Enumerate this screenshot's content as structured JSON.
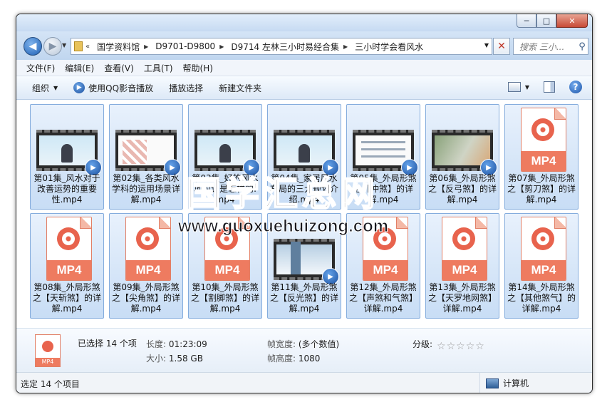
{
  "window": {
    "minimize": "─",
    "maximize": "□",
    "close": "✕"
  },
  "nav": {
    "breadcrumbs": [
      "国学资料馆",
      "D9701-D9800",
      "D9714 左林三小时易经合集",
      "三小时学会看风水"
    ],
    "search_placeholder": "搜索 三小...",
    "back_icon": "back-arrow-icon",
    "forward_icon": "forward-arrow-icon"
  },
  "menu": [
    "文件(F)",
    "编辑(E)",
    "查看(V)",
    "工具(T)",
    "帮助(H)"
  ],
  "toolbar": {
    "organize": "组织",
    "play_qq": "使用QQ影音播放",
    "play_selected": "播放选择",
    "new_folder": "新建文件夹"
  },
  "files": [
    {
      "name": "第01集_风水对于改善运势的重要性.mp4",
      "thumb": "video-person"
    },
    {
      "name": "第02集_各类风水学科的运用场景详解.mp4",
      "thumb": "video-doc-grid"
    },
    {
      "name": "第03集_好的风水地应该是怎样的.mp4",
      "thumb": "video-person"
    },
    {
      "name": "第04集_家居风水布局的三大规划介绍.mp4",
      "thumb": "video-person"
    },
    {
      "name": "第05集_外局形煞之【冲煞】的详解.mp4",
      "thumb": "video-doc"
    },
    {
      "name": "第06集_外局形煞之【反弓煞】的详解.mp4",
      "thumb": "video-map"
    },
    {
      "name": "第07集_外局形煞之【剪刀煞】的详解.mp4",
      "thumb": "mp4"
    },
    {
      "name": "第08集_外局形煞之【天斩煞】的详解.mp4",
      "thumb": "mp4"
    },
    {
      "name": "第09集_外局形煞之【尖角煞】的详解.mp4",
      "thumb": "mp4"
    },
    {
      "name": "第10集_外局形煞之【割脚煞】的详解.mp4",
      "thumb": "mp4"
    },
    {
      "name": "第11集_外局形煞之【反光煞】的详解.mp4",
      "thumb": "video-building"
    },
    {
      "name": "第12集_外局形煞之【声煞和气煞】详解.mp4",
      "thumb": "mp4"
    },
    {
      "name": "第13集_外局形煞之【天罗地网煞】详解.mp4",
      "thumb": "mp4"
    },
    {
      "name": "第14集_外局形煞之【其他煞气】的详解.mp4",
      "thumb": "mp4"
    }
  ],
  "file_type_label": "MP4",
  "details": {
    "selected": "已选择 14 个项",
    "length_label": "长度:",
    "length_value": "01:23:09",
    "size_label": "大小:",
    "size_value": "1.58 GB",
    "frame_width_label": "帧宽度:",
    "frame_width_value": "(多个数值)",
    "frame_height_label": "帧高度:",
    "frame_height_value": "1080",
    "rating_label": "分级:",
    "rating_stars": 5,
    "rating_value": 0
  },
  "status": {
    "left": "选定 14 个项目",
    "right": "计算机"
  },
  "watermark": {
    "cn": "国学汇总网",
    "url": "www.guoxuehuizong.com"
  }
}
